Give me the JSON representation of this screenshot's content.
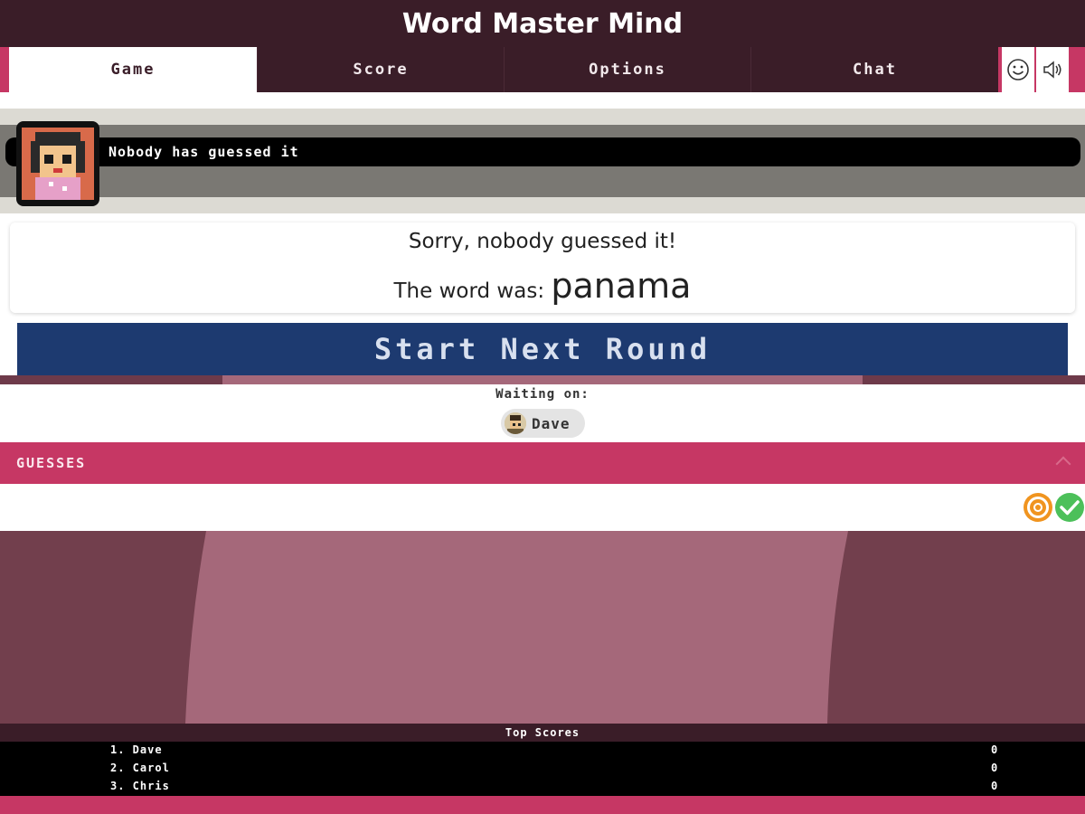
{
  "header": {
    "title": "Word Master Mind"
  },
  "tabs": [
    {
      "label": "Game",
      "active": true
    },
    {
      "label": "Score",
      "active": false
    },
    {
      "label": "Options",
      "active": false
    },
    {
      "label": "Chat",
      "active": false
    }
  ],
  "toolbar_icons": [
    "smiley-icon",
    "speaker-icon"
  ],
  "status": {
    "message": "Nobody has guessed it"
  },
  "result": {
    "line1": "Sorry, nobody guessed it!",
    "line2_prefix": "The word was:",
    "word": "panama"
  },
  "start_button": {
    "label": "Start Next Round"
  },
  "timer": {
    "progress": 0.59
  },
  "waiting": {
    "label": "Waiting on:",
    "player": "Dave"
  },
  "guesses": {
    "header": "Guesses"
  },
  "guess_status_icons": [
    "target-icon",
    "check-icon"
  ],
  "top_scores": {
    "title": "Top Scores",
    "rows": [
      {
        "name": "1. Dave",
        "score": "0"
      },
      {
        "name": "2. Carol",
        "score": "0"
      },
      {
        "name": "3. Chris",
        "score": "0"
      }
    ]
  },
  "colors": {
    "dark_maroon": "#3a1d28",
    "accent_pink": "#c63764",
    "button_navy": "#1d3a70",
    "field_maroon": "#723f4d",
    "field_light": "#a5687a"
  }
}
